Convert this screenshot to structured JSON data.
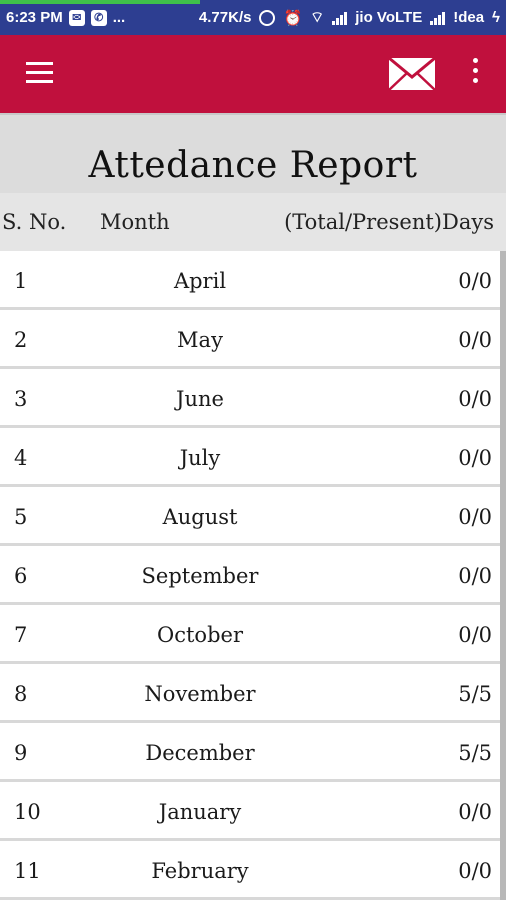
{
  "status_bar": {
    "time": "6:23 PM",
    "dots": "...",
    "speed": "4.77K/s",
    "carrier1": "jio VoLTE",
    "carrier2": "!dea"
  },
  "app_bar": {
    "background_color": "#c0103d"
  },
  "page": {
    "title": "Attedance Report"
  },
  "table": {
    "headers": {
      "sno": "S. No.",
      "month": "Month",
      "days": "(Total/Present)Days"
    },
    "rows": [
      {
        "sno": "1",
        "month": "April",
        "days": "0/0"
      },
      {
        "sno": "2",
        "month": "May",
        "days": "0/0"
      },
      {
        "sno": "3",
        "month": "June",
        "days": "0/0"
      },
      {
        "sno": "4",
        "month": "July",
        "days": "0/0"
      },
      {
        "sno": "5",
        "month": "August",
        "days": "0/0"
      },
      {
        "sno": "6",
        "month": "September",
        "days": "0/0"
      },
      {
        "sno": "7",
        "month": "October",
        "days": "0/0"
      },
      {
        "sno": "8",
        "month": "November",
        "days": "5/5"
      },
      {
        "sno": "9",
        "month": "December",
        "days": "5/5"
      },
      {
        "sno": "10",
        "month": "January",
        "days": "0/0"
      },
      {
        "sno": "11",
        "month": "February",
        "days": "0/0"
      }
    ]
  }
}
